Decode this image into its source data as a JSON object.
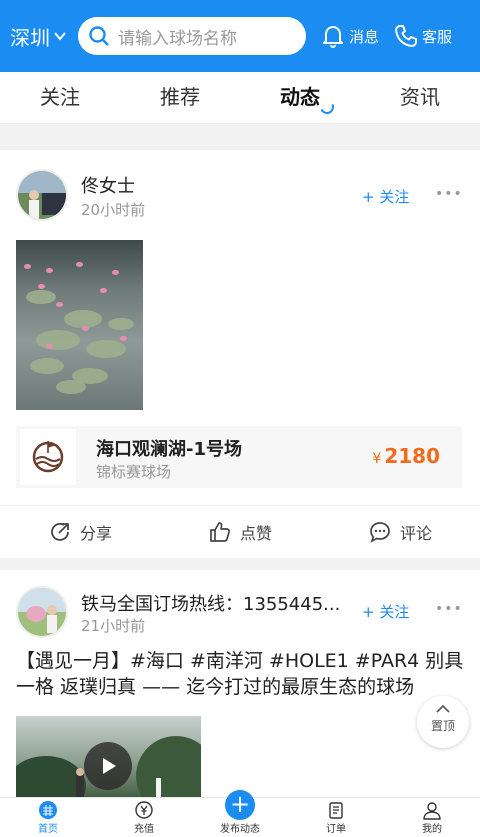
{
  "header": {
    "city": "深圳",
    "search_placeholder": "请输入球场名称",
    "messages_label": "消息",
    "service_label": "客服"
  },
  "tabs": [
    {
      "label": "关注",
      "active": false
    },
    {
      "label": "推荐",
      "active": false
    },
    {
      "label": "动态",
      "active": true
    },
    {
      "label": "资讯",
      "active": false
    }
  ],
  "posts": [
    {
      "user": "佟女士",
      "time": "20小时前",
      "follow_label": "+ 关注",
      "more": "•••",
      "venue": {
        "name": "海口观澜湖-1号场",
        "type": "锦标赛球场",
        "currency": "¥",
        "price": "2180"
      },
      "actions": {
        "share": "分享",
        "like": "点赞",
        "comment": "评论"
      }
    },
    {
      "user": "铁马全国订场热线：1355445...",
      "time": "21小时前",
      "follow_label": "+ 关注",
      "more": "•••",
      "text": "【遇见一月】#海口 #南洋河 #HOLE1 #PAR4 别具一格 返璞归真 —— 迄今打过的最原生态的球场"
    }
  ],
  "to_top_label": "置顶",
  "bottom_nav": [
    {
      "label": "首页",
      "icon": "home-icon",
      "active": true
    },
    {
      "label": "充值",
      "icon": "recharge-icon",
      "active": false
    },
    {
      "label": "发布动态",
      "icon": "publish-icon",
      "active": false
    },
    {
      "label": "订单",
      "icon": "order-icon",
      "active": false
    },
    {
      "label": "我的",
      "icon": "profile-icon",
      "active": false
    }
  ],
  "colors": {
    "primary": "#1a8cf2",
    "price": "#f26a1b"
  }
}
